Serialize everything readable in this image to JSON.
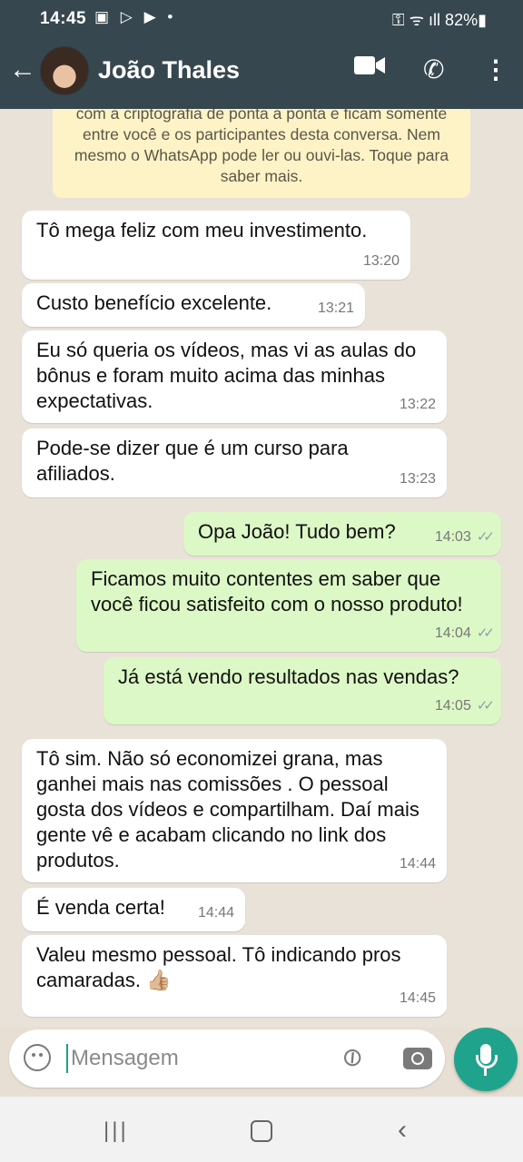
{
  "status_bar": {
    "time": "14:45",
    "left_icons": "▣ ▷ ▶ •",
    "right": "⚿ ᯤ ıll 82%▮"
  },
  "header": {
    "back_glyph": "←",
    "contact_name": "João Thales",
    "video_glyph": "",
    "call_glyph": "✆",
    "more_glyph": "⋮"
  },
  "notice": "com a criptografia de ponta a ponta e ficam somente entre você e os participantes desta conversa. Nem mesmo o WhatsApp pode ler ou ouvi-las. Toque para saber mais.",
  "messages": [
    {
      "dir": "in",
      "text": "Tô mega feliz com meu investimento.",
      "time": "13:20"
    },
    {
      "dir": "in",
      "text": "Custo benefício excelente.",
      "time": "13:21"
    },
    {
      "dir": "in",
      "text": "Eu só queria os vídeos, mas vi as aulas do bônus e foram muito acima das minhas expectativas.",
      "time": "13:22"
    },
    {
      "dir": "in",
      "text": "Pode-se dizer que é um curso para afiliados.",
      "time": "13:23"
    },
    {
      "dir": "out",
      "text": "Opa João! Tudo bem?",
      "time": "14:03",
      "ticks": "✓✓"
    },
    {
      "dir": "out",
      "text": "Ficamos muito contentes em saber que você ficou satisfeito com o nosso produto!",
      "time": "14:04",
      "ticks": "✓✓"
    },
    {
      "dir": "out",
      "text": "Já está vendo resultados nas vendas?",
      "time": "14:05",
      "ticks": "✓✓"
    },
    {
      "dir": "in",
      "text": "Tô sim. Não só economizei grana, mas ganhei mais nas comissões . O pessoal gosta dos vídeos e compartilham. Daí mais gente vê e acabam clicando no link dos produtos.",
      "time": "14:44"
    },
    {
      "dir": "in",
      "text": "É venda certa!",
      "time": "14:44"
    },
    {
      "dir": "in",
      "text": "Valeu mesmo pessoal. Tô indicando pros camaradas. 👍🏼",
      "time": "14:45"
    }
  ],
  "input": {
    "placeholder": "Mensagem"
  },
  "nav": {
    "recent": "|||",
    "back": "‹"
  },
  "colors": {
    "header": "#37474f",
    "outgoing": "#dcf8c6",
    "incoming": "#ffffff",
    "accent": "#1fa38c",
    "notice": "#fdf3c6"
  }
}
